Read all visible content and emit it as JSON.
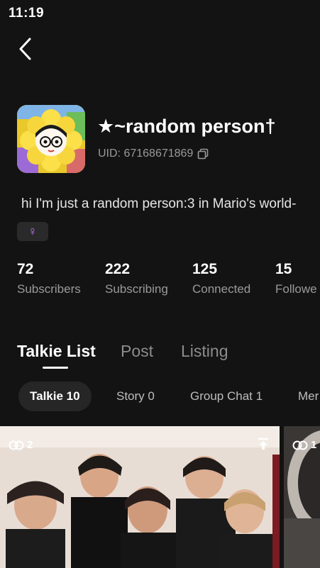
{
  "status_bar": {
    "time": "11:19"
  },
  "profile": {
    "name": "★~random person†",
    "uid": "UID: 67168671869",
    "bio": "hi I'm just a random person:3 in Mario's world-",
    "gender_symbol": "♀"
  },
  "stats": [
    {
      "value": "72",
      "label": "Subscribers"
    },
    {
      "value": "222",
      "label": "Subscribing"
    },
    {
      "value": "125",
      "label": "Connected"
    },
    {
      "value": "15",
      "label": "Followe"
    }
  ],
  "tabs": [
    {
      "label": "Talkie List",
      "active": true
    },
    {
      "label": "Post",
      "active": false
    },
    {
      "label": "Listing",
      "active": false
    }
  ],
  "filters": [
    {
      "label": "Talkie 10",
      "active": true
    },
    {
      "label": "Story 0",
      "active": false
    },
    {
      "label": "Group Chat 1",
      "active": false
    },
    {
      "label": "Mer",
      "active": false
    }
  ],
  "cards": [
    {
      "link_count": "2"
    },
    {
      "link_count": "1"
    }
  ],
  "colors": {
    "background": "#131313",
    "gender_accent": "#c678ff",
    "muted_text": "#9a9a9a"
  }
}
